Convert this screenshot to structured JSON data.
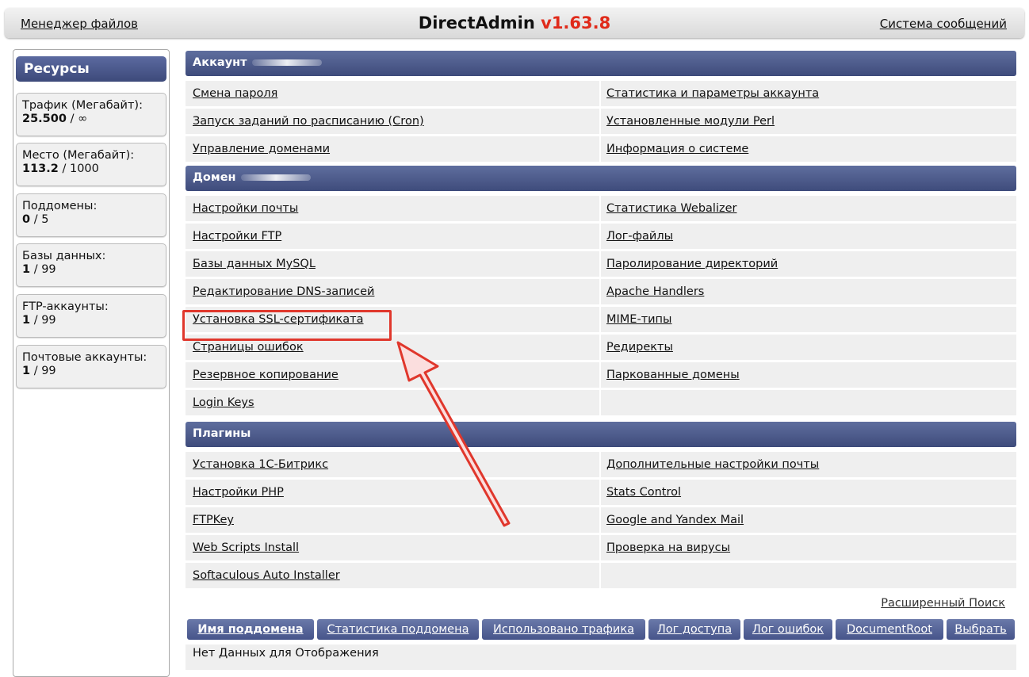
{
  "topbar": {
    "file_manager": "Менеджер файлов",
    "brand": "DirectAdmin",
    "version": "v1.63.8",
    "messages": "Система сообщений"
  },
  "sidebar": {
    "title": "Ресурсы",
    "items": [
      {
        "label": "Трафик (Мегабайт):",
        "used": "25.500",
        "limit": " / ∞"
      },
      {
        "label": "Место (Мегабайт):",
        "used": "113.2",
        "limit": " / 1000"
      },
      {
        "label": "Поддомены:",
        "used": "0",
        "limit": " / 5"
      },
      {
        "label": "Базы данных:",
        "used": "1",
        "limit": " / 99"
      },
      {
        "label": "FTP-аккаунты:",
        "used": "1",
        "limit": " / 99"
      },
      {
        "label": "Почтовые аккаунты:",
        "used": "1",
        "limit": " / 99"
      }
    ]
  },
  "sections": {
    "account": {
      "title": "Аккаунт",
      "rows": [
        [
          "Смена пароля",
          "Статистика и параметры аккаунта"
        ],
        [
          "Запуск заданий по расписанию (Cron)",
          "Установленные модули Perl"
        ],
        [
          "Управление доменами",
          "Информация о системе"
        ]
      ]
    },
    "domain": {
      "title": "Домен",
      "rows": [
        [
          "Настройки почты",
          "Статистика Webalizer"
        ],
        [
          "Настройки FTP",
          "Лог-файлы"
        ],
        [
          "Базы данных MySQL",
          "Паролирование директорий"
        ],
        [
          "Редактирование DNS-записей",
          "Apache Handlers"
        ],
        [
          "Установка SSL-сертификата",
          "MIME-типы"
        ],
        [
          "Страницы ошибок",
          "Редиректы"
        ],
        [
          "Резервное копирование",
          "Паркованные домены"
        ],
        [
          "Login Keys",
          ""
        ]
      ]
    },
    "plugins": {
      "title": "Плагины",
      "rows": [
        [
          "Установка 1С-Битрикс",
          "Дополнительные настройки почты"
        ],
        [
          "Настройки PHP",
          "Stats Control"
        ],
        [
          "FTPKey",
          "Google and Yandex Mail"
        ],
        [
          "Web Scripts Install",
          "Проверка на вирусы"
        ],
        [
          "Softaculous Auto Installer",
          ""
        ]
      ]
    }
  },
  "advanced_search": "Расширенный Поиск",
  "subdomain_table": {
    "columns": [
      "Имя поддомена",
      "Статистика поддомена",
      "Использовано трафика",
      "Лог доступа",
      "Лог ошибок",
      "DocumentRoot",
      "Выбрать"
    ],
    "empty_text": "Нет Данных для Отображения"
  },
  "colors": {
    "header_bar": "#4a5785",
    "version": "#e02a1a",
    "annotation": "#e0372c",
    "row_bg": "#efefef"
  }
}
